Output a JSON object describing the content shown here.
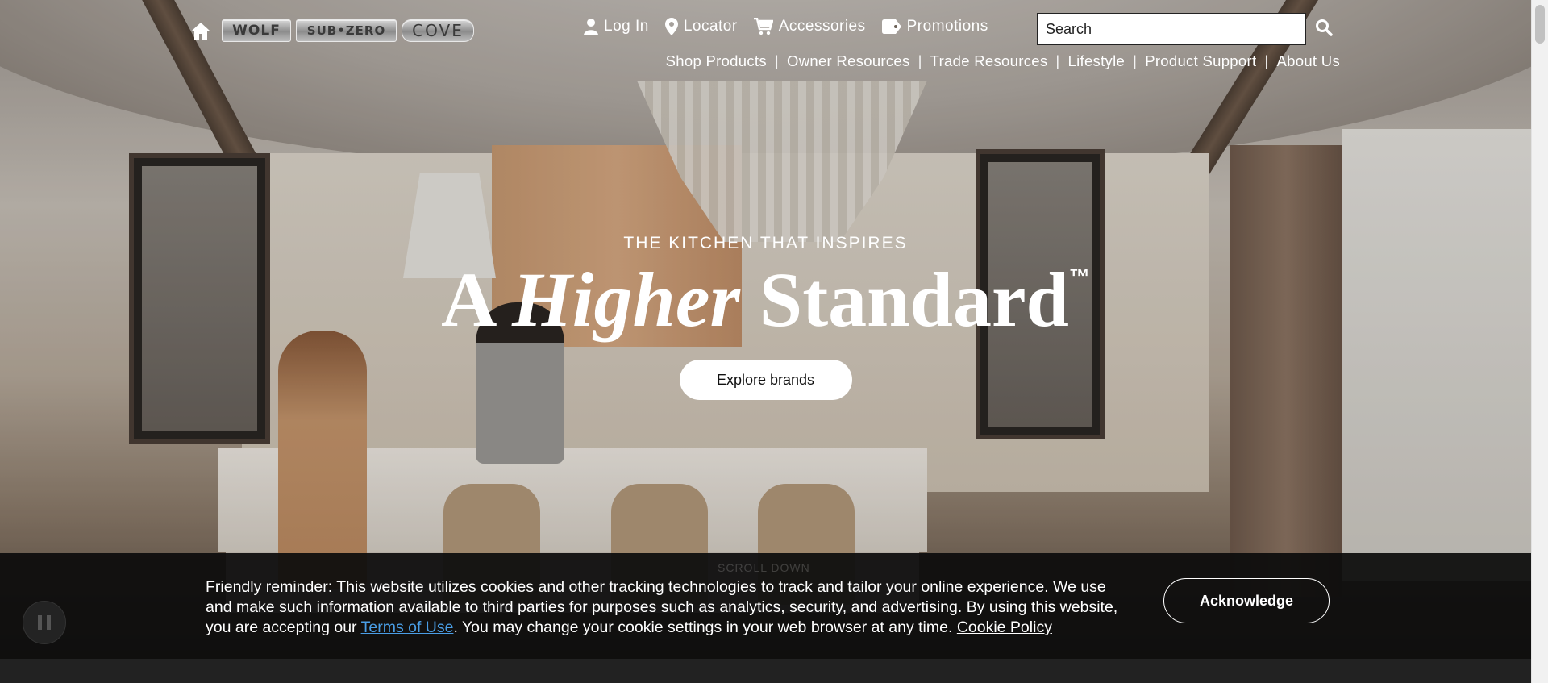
{
  "header": {
    "brands": [
      {
        "name": "WOLF",
        "icon": "wolf-logo"
      },
      {
        "name": "SUB•ZERO",
        "icon": "subzero-logo"
      },
      {
        "name": "COVE",
        "icon": "cove-logo"
      }
    ],
    "utility_nav": [
      {
        "label": "Log In",
        "icon": "user-icon"
      },
      {
        "label": "Locator",
        "icon": "map-pin-icon"
      },
      {
        "label": "Accessories",
        "icon": "cart-icon"
      },
      {
        "label": "Promotions",
        "icon": "tag-icon"
      }
    ],
    "search": {
      "placeholder": "Search",
      "icon": "search-icon"
    },
    "main_nav": [
      "Shop Products",
      "Owner Resources",
      "Trade Resources",
      "Lifestyle",
      "Product Support",
      "About Us"
    ]
  },
  "hero": {
    "eyebrow": "THE KITCHEN THAT INSPIRES",
    "headline_part1": "A ",
    "headline_italic": "Higher",
    "headline_part2": " Standard",
    "headline_tm": "™",
    "cta": "Explore brands",
    "scroll_hint": "SCROLL DOWN"
  },
  "cookie_banner": {
    "text_part1": "Friendly reminder: This website utilizes cookies and other tracking technologies to track and tailor your online experience. We use and make such information available to third parties for purposes such as analytics, security, and advertising. By using this website, you are accepting our ",
    "terms_link": "Terms of Use",
    "text_part2": ". You may change your cookie settings in your web browser at any time. ",
    "policy_link": "Cookie Policy",
    "acknowledge": "Acknowledge"
  },
  "colors": {
    "link": "#4a9ee6",
    "banner_bg": "#0c0c0c",
    "text": "#ffffff"
  }
}
